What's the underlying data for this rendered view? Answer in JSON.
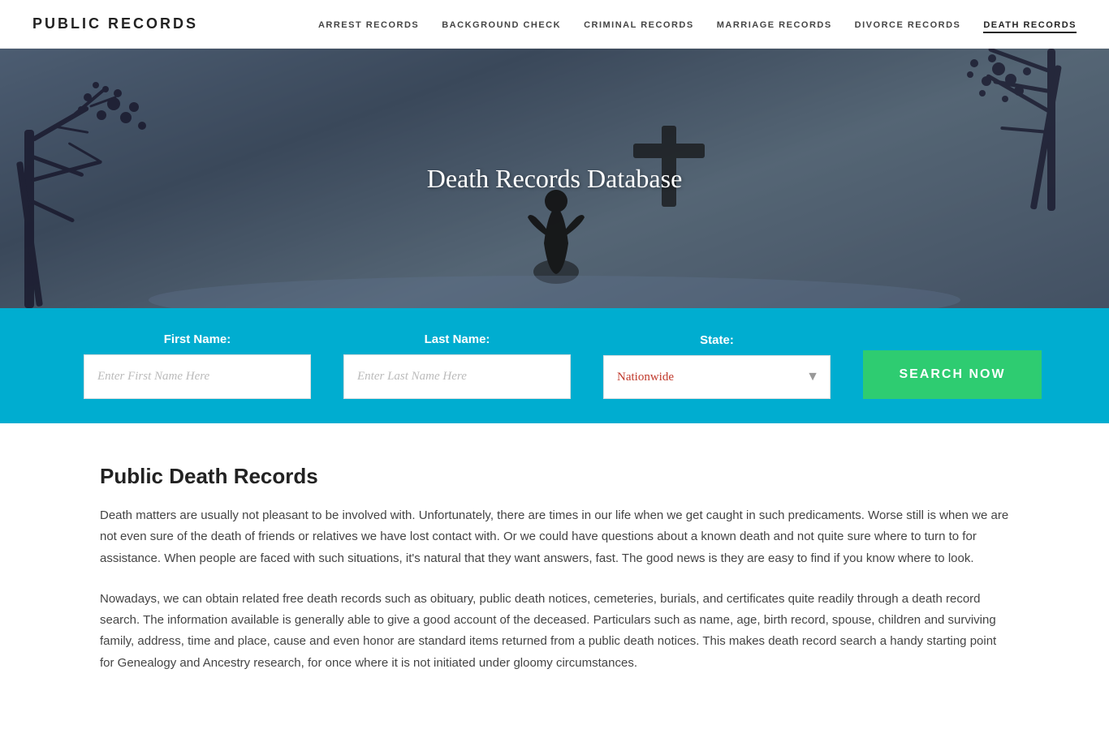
{
  "nav": {
    "logo": "PUBLIC RECORDS",
    "links": [
      {
        "label": "ARREST RECORDS",
        "active": false
      },
      {
        "label": "BACKGROUND CHECK",
        "active": false
      },
      {
        "label": "CRIMINAL RECORDS",
        "active": false
      },
      {
        "label": "MARRIAGE RECORDS",
        "active": false
      },
      {
        "label": "DIVORCE RECORDS",
        "active": false
      },
      {
        "label": "DEATH RECORDS",
        "active": true
      }
    ]
  },
  "hero": {
    "title": "Death Records Database"
  },
  "search": {
    "first_name_label": "First Name:",
    "first_name_placeholder": "Enter First Name Here",
    "last_name_label": "Last Name:",
    "last_name_placeholder": "Enter Last Name Here",
    "state_label": "State:",
    "state_value": "Nationwide",
    "button_label": "SEARCH NOW"
  },
  "content": {
    "heading": "Public Death Records",
    "paragraph1": "Death matters are usually not pleasant to be involved with. Unfortunately, there are times in our life when we get caught in such predicaments. Worse still is when we are not even sure of the death of friends or relatives we have lost contact with. Or we could have questions about a known death and not quite sure where to turn to for assistance. When people are faced with such situations, it's natural that they want answers, fast. The good news is they are easy to find if you know where to look.",
    "paragraph2": "Nowadays, we can obtain related free death records such as obituary, public death notices, cemeteries, burials, and certificates quite readily through a death record search. The information available is generally able to give a good account of the deceased. Particulars such as name, age, birth record, spouse, children and surviving family, address, time and place, cause and even honor are standard items returned from a public death notices. This makes death record search a handy starting point for Genealogy and Ancestry research, for once where it is not initiated under gloomy circumstances."
  }
}
